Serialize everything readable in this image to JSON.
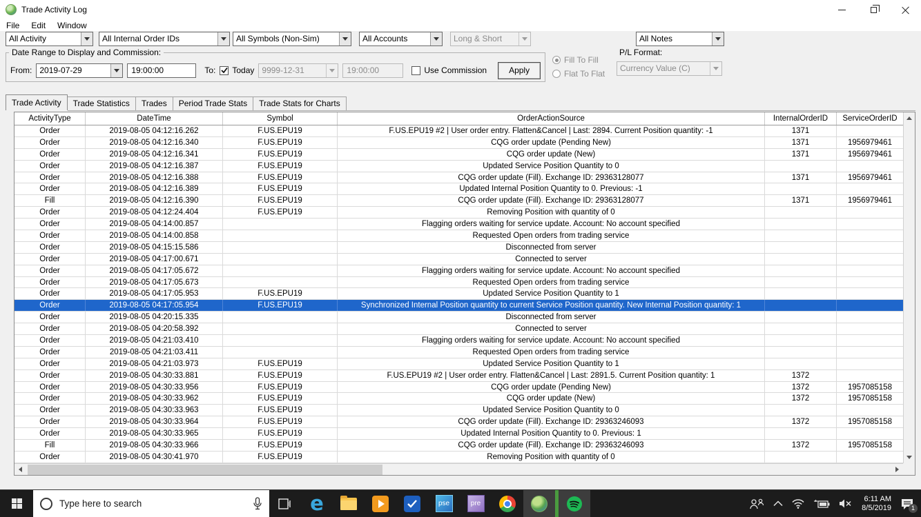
{
  "window": {
    "title": "Trade Activity Log",
    "menu": [
      "File",
      "Edit",
      "Window"
    ]
  },
  "filters": {
    "activity": "All Activity",
    "internal_order_ids": "All Internal Order IDs",
    "symbols": "All Symbols (Non-Sim)",
    "accounts": "All Accounts",
    "long_short": "Long & Short",
    "notes": "All Notes"
  },
  "date_range": {
    "legend": "Date Range to Display and Commission:",
    "from_label": "From:",
    "from_date": "2019-07-29",
    "from_time": "19:00:00",
    "to_label": "To:",
    "today_label": "Today",
    "today_checked": true,
    "to_date": "9999-12-31",
    "to_time": "19:00:00",
    "use_commission_label": "Use Commission",
    "use_commission_checked": false,
    "apply_label": "Apply"
  },
  "pl_options": {
    "fill_to_fill_label": "Fill To Fill",
    "flat_to_flat_label": "Flat To Flat",
    "selected": "fill_to_fill",
    "pl_format_label": "P/L Format:",
    "pl_format_value": "Currency Value (C)"
  },
  "tabs": [
    {
      "label": "Trade Activity",
      "active": true
    },
    {
      "label": "Trade Statistics",
      "active": false
    },
    {
      "label": "Trades",
      "active": false
    },
    {
      "label": "Period Trade Stats",
      "active": false
    },
    {
      "label": "Trade Stats for Charts",
      "active": false
    }
  ],
  "grid": {
    "columns": [
      "ActivityType",
      "DateTime",
      "Symbol",
      "OrderActionSource",
      "InternalOrderID",
      "ServiceOrderID"
    ],
    "selected_index": 15,
    "rows": [
      [
        "Order",
        "2019-08-05 04:12:16.262",
        "F.US.EPU19",
        "F.US.EPU19  #2 | User order entry. Flatten&Cancel | Last: 2894. Current Position quantity: -1",
        "1371",
        ""
      ],
      [
        "Order",
        "2019-08-05 04:12:16.340",
        "F.US.EPU19",
        "CQG order update (Pending New)",
        "1371",
        "1956979461"
      ],
      [
        "Order",
        "2019-08-05 04:12:16.341",
        "F.US.EPU19",
        "CQG order update (New)",
        "1371",
        "1956979461"
      ],
      [
        "Order",
        "2019-08-05 04:12:16.387",
        "F.US.EPU19",
        "Updated Service Position Quantity to 0",
        "",
        ""
      ],
      [
        "Order",
        "2019-08-05 04:12:16.388",
        "F.US.EPU19",
        "CQG order update (Fill). Exchange ID: 29363128077",
        "1371",
        "1956979461"
      ],
      [
        "Order",
        "2019-08-05 04:12:16.389",
        "F.US.EPU19",
        "Updated Internal Position Quantity to 0. Previous: -1",
        "",
        ""
      ],
      [
        "Fill",
        "2019-08-05 04:12:16.390",
        "F.US.EPU19",
        "CQG order update (Fill). Exchange ID: 29363128077",
        "1371",
        "1956979461"
      ],
      [
        "Order",
        "2019-08-05 04:12:24.404",
        "F.US.EPU19",
        "Removing Position with quantity of 0",
        "",
        ""
      ],
      [
        "Order",
        "2019-08-05 04:14:00.857",
        "",
        "Flagging orders waiting for service update. Account: No account specified",
        "",
        ""
      ],
      [
        "Order",
        "2019-08-05 04:14:00.858",
        "",
        "Requested Open orders from trading service",
        "",
        ""
      ],
      [
        "Order",
        "2019-08-05 04:15:15.586",
        "",
        "Disconnected from server",
        "",
        ""
      ],
      [
        "Order",
        "2019-08-05 04:17:00.671",
        "",
        "Connected to server",
        "",
        ""
      ],
      [
        "Order",
        "2019-08-05 04:17:05.672",
        "",
        "Flagging orders waiting for service update. Account: No account specified",
        "",
        ""
      ],
      [
        "Order",
        "2019-08-05 04:17:05.673",
        "",
        "Requested Open orders from trading service",
        "",
        ""
      ],
      [
        "Order",
        "2019-08-05 04:17:05.953",
        "F.US.EPU19",
        "Updated Service Position Quantity to 1",
        "",
        ""
      ],
      [
        "Order",
        "2019-08-05 04:17:05.954",
        "F.US.EPU19",
        "Synchronized Internal Position quantity to current Service Position quantity. New Internal Position quantity: 1",
        "",
        ""
      ],
      [
        "Order",
        "2019-08-05 04:20:15.335",
        "",
        "Disconnected from server",
        "",
        ""
      ],
      [
        "Order",
        "2019-08-05 04:20:58.392",
        "",
        "Connected to server",
        "",
        ""
      ],
      [
        "Order",
        "2019-08-05 04:21:03.410",
        "",
        "Flagging orders waiting for service update. Account: No account specified",
        "",
        ""
      ],
      [
        "Order",
        "2019-08-05 04:21:03.411",
        "",
        "Requested Open orders from trading service",
        "",
        ""
      ],
      [
        "Order",
        "2019-08-05 04:21:03.973",
        "F.US.EPU19",
        "Updated Service Position Quantity to 1",
        "",
        ""
      ],
      [
        "Order",
        "2019-08-05 04:30:33.881",
        "F.US.EPU19",
        "F.US.EPU19  #2 | User order entry. Flatten&Cancel | Last: 2891.5. Current Position quantity: 1",
        "1372",
        ""
      ],
      [
        "Order",
        "2019-08-05 04:30:33.956",
        "F.US.EPU19",
        "CQG order update (Pending New)",
        "1372",
        "1957085158"
      ],
      [
        "Order",
        "2019-08-05 04:30:33.962",
        "F.US.EPU19",
        "CQG order update (New)",
        "1372",
        "1957085158"
      ],
      [
        "Order",
        "2019-08-05 04:30:33.963",
        "F.US.EPU19",
        "Updated Service Position Quantity to 0",
        "",
        ""
      ],
      [
        "Order",
        "2019-08-05 04:30:33.964",
        "F.US.EPU19",
        "CQG order update (Fill). Exchange ID: 29363246093",
        "1372",
        "1957085158"
      ],
      [
        "Order",
        "2019-08-05 04:30:33.965",
        "F.US.EPU19",
        "Updated Internal Position Quantity to 0. Previous: 1",
        "",
        ""
      ],
      [
        "Fill",
        "2019-08-05 04:30:33.966",
        "F.US.EPU19",
        "CQG order update (Fill). Exchange ID: 29363246093",
        "1372",
        "1957085158"
      ],
      [
        "Order",
        "2019-08-05 04:30:41.970",
        "F.US.EPU19",
        "Removing Position with quantity of 0",
        "",
        ""
      ]
    ]
  },
  "taskbar": {
    "search_placeholder": "Type here to search",
    "pse_label": "pse",
    "pre_label": "pre",
    "clock": {
      "time": "6:11 AM",
      "date": "8/5/2019"
    },
    "notification_badge": "1",
    "colors": {
      "selection_blue": "#1f66cb",
      "taskbar_bg": "#1c1c1c",
      "indicator_green": "#4a9b3f"
    }
  }
}
